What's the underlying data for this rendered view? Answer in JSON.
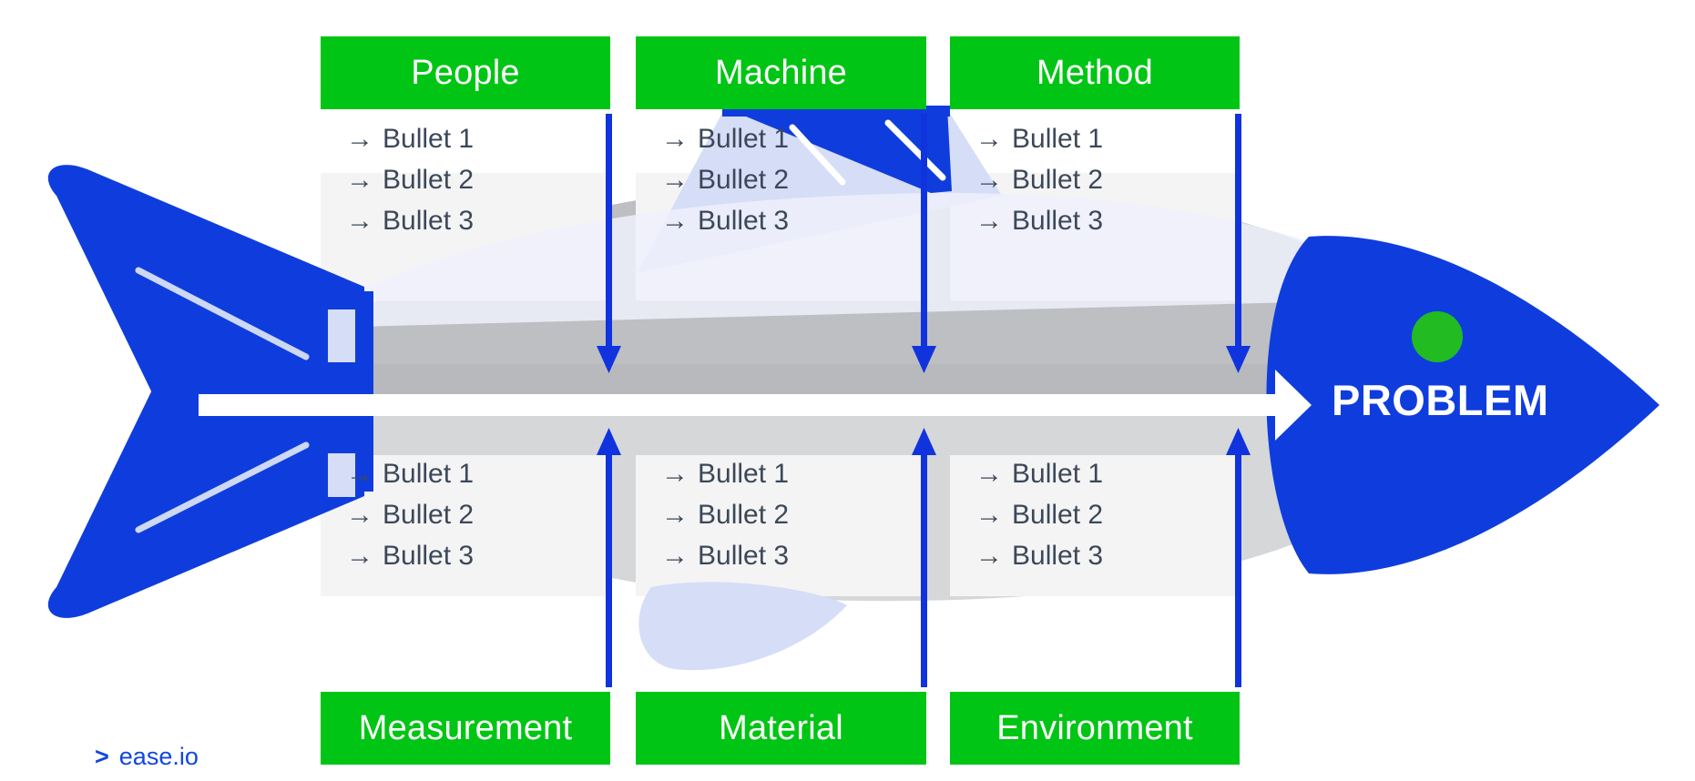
{
  "diagram": {
    "type": "fishbone-ishikawa",
    "problem_label": "PROBLEM",
    "bullet_arrow_glyph": "→",
    "colors": {
      "category_box": "#00c514",
      "category_text": "#ffffff",
      "bullet_text": "#3c4858",
      "fish_body_blue": "#0f3ddd",
      "fish_fin_light": "#d6ddf7",
      "spine_white": "#ffffff",
      "band_dark_gray": "#b7b9bc",
      "band_light_gray": "#d5d7d9",
      "panel_gray": "#f4f4f5",
      "eye_green": "#22bb22",
      "arrow_blue": "#1033dd",
      "brand_blue": "#1146e0"
    }
  },
  "top_categories": [
    {
      "name": "people",
      "label": "People",
      "bullets": [
        "Bullet 1",
        "Bullet 2",
        "Bullet 3"
      ]
    },
    {
      "name": "machine",
      "label": "Machine",
      "bullets": [
        "Bullet 1",
        "Bullet 2",
        "Bullet 3"
      ]
    },
    {
      "name": "method",
      "label": "Method",
      "bullets": [
        "Bullet 1",
        "Bullet 2",
        "Bullet 3"
      ]
    }
  ],
  "bottom_categories": [
    {
      "name": "measurement",
      "label": "Measurement",
      "bullets": [
        "Bullet 1",
        "Bullet 2",
        "Bullet 3"
      ]
    },
    {
      "name": "material",
      "label": "Material",
      "bullets": [
        "Bullet 1",
        "Bullet 2",
        "Bullet 3"
      ]
    },
    {
      "name": "environment",
      "label": "Environment",
      "bullets": [
        "Bullet 1",
        "Bullet 2",
        "Bullet 3"
      ]
    }
  ],
  "brand": {
    "chevron": ">",
    "name": "ease.io"
  }
}
